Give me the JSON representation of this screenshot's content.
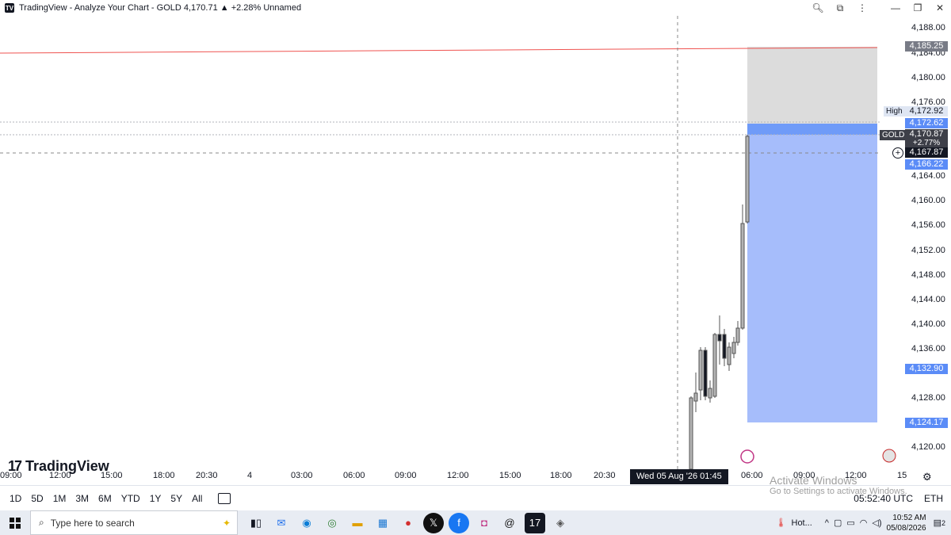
{
  "window": {
    "title": "TradingView - Analyze Your Chart - GOLD 4,170.71 ▲ +2.28% Unnamed",
    "logo_text": "TV"
  },
  "price_scale": {
    "ticks": [
      "4,188.00",
      "4,184.00",
      "4,180.00",
      "4,176.00",
      "4,164.00",
      "4,160.00",
      "4,156.00",
      "4,152.00",
      "4,148.00",
      "4,144.00",
      "4,140.00",
      "4,136.00",
      "4,128.00",
      "4,120.00"
    ],
    "tags": {
      "stop_price": "4,185.25",
      "high_label": "High",
      "high_price": "4,172.92",
      "entry_price": "4,172.62",
      "symbol": "GOLD",
      "last_price": "4,170.87",
      "change_pct": "+2.77%",
      "crosshair_price": "4,167.87",
      "blue_price": "4,166.22",
      "low_blue": "4,132.90",
      "target_price": "4,124.17"
    }
  },
  "watermark": {
    "brand": "TradingView",
    "mark": "17"
  },
  "time_scale": {
    "labels": [
      "09:00",
      "12:00",
      "15:00",
      "18:00",
      "20:30",
      "4",
      "03:00",
      "06:00",
      "09:00",
      "12:00",
      "15:00",
      "18:00",
      "20:30",
      "06:00",
      "09:00",
      "12:00",
      "15"
    ],
    "crosshair": "Wed 05 Aug '26   01:45"
  },
  "activate_windows": {
    "title": "Activate Windows",
    "subtitle": "Go to Settings to activate Windows."
  },
  "bottom_toolbar": {
    "ranges": [
      "1D",
      "5D",
      "1M",
      "3M",
      "6M",
      "YTD",
      "1Y",
      "5Y",
      "All"
    ],
    "clock": "05:52:40 UTC",
    "session": "ETH"
  },
  "taskbar": {
    "search_placeholder": "Type here to search",
    "weather": "Hot...",
    "time": "10:52 AM",
    "date": "05/08/2026",
    "notif_count": "2"
  },
  "colors": {
    "stop_zone": "#dcdcdc",
    "target_zone": "#a6bdfb",
    "entry_line": "#5b8cf7",
    "red_line": "#ef5350"
  }
}
